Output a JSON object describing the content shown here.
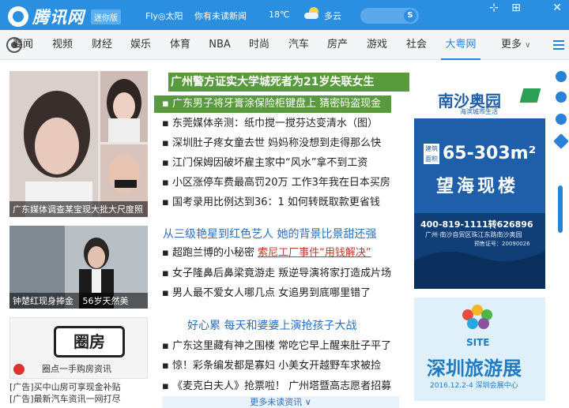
{
  "titlebar": {
    "logo_text": "腾讯网",
    "mini_badge": "迷你版",
    "fly_sun": "Fly◎太阳",
    "unread": "你有未读新闻",
    "temperature": "18℃",
    "weather": "多云",
    "search_button": "S",
    "pin": "⊹",
    "restore": "⊞",
    "close": "✕"
  },
  "nav": {
    "items": [
      "要闻",
      "视频",
      "财经",
      "娱乐",
      "体育",
      "NBA",
      "时尚",
      "汽车",
      "房产",
      "游戏",
      "社会",
      "大粤网"
    ],
    "more": "更多",
    "active": "大粤网"
  },
  "left": {
    "photo1_caption": "广东媒体调查某宝现大批大尺度照",
    "photo2_caption": "钟楚红现身捧金",
    "photo2_caption2": "56岁天然美",
    "ad_logo": "圈房",
    "ad_logo_sub": "圈点一手购房资讯",
    "ad_line1": "[广告]买中山房可享现金补贴",
    "ad_line2": "[广告]最新汽车资讯一网打尽"
  },
  "center": {
    "headline": "广州警方证实大学城死者为21岁失联女生",
    "lines1": [
      "广东男子将牙膏涂保险柜键盘上  猜密码盗现金",
      "东莞媒体亲测：纸巾搅一搅芬达变清水（图）",
      "深圳肚子疼女童去世  妈妈称没想到走得那么快",
      "江门保姆因破坏雇主家中“风水”拿不到工资",
      "小区涨停车费最高罚20万  工作3年我在日本买房",
      "国考录用比例达到36：1  如何转既取款更省钱"
    ],
    "section2_title": "从三级艳星到红色艺人  她的背景比景甜还强",
    "lines2_first_plain": "超跑兰博的小秘密",
    "lines2_first_link": "索尼工厂事件“用钱解决”",
    "lines2": [
      "女子隆鼻后鼻梁竟游走  叛逆导演将家打造成片场",
      "男人最不爱女人哪几点  女追男到底哪里错了"
    ],
    "section3_title": "好心累  每天和婆婆上演抢孩子大战",
    "lines3": [
      "广东这里藏有神之围楼  常吃它早上醒来肚子平了",
      "惊！彩条编发都是寡妇  小美女开越野车求被捡",
      "《麦克白夫人》抢票啦！  广州塔暨高志愿者招募"
    ],
    "more_news": "更多未读资讯"
  },
  "right_ad1": {
    "brand": "南沙奥园",
    "brand_sub": "海滨城市生活",
    "area_tag": "建筑面积",
    "area": "65-303m²",
    "slogan": "望海现楼",
    "phone": "400-819-1111转626896",
    "address": "广州·南沙自贸区珠江东路南沙奥园",
    "license": "预售证号：20090026"
  },
  "right_ad2": {
    "logo": "SITE",
    "title": "深圳旅游展",
    "date": "2016.12.2-4  深圳会展中心"
  },
  "colors": {
    "brand_blue": "#2a8fe0",
    "headline_green": "#5a9a3e",
    "link_blue": "#2a6fc0",
    "alert_red": "#c0392b"
  }
}
